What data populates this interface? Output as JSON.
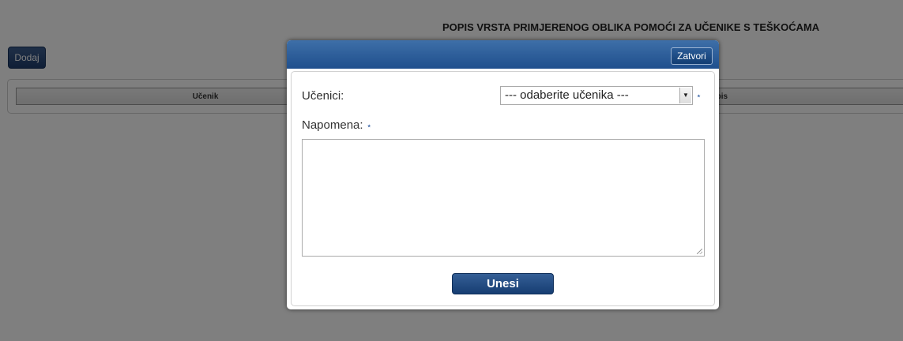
{
  "page": {
    "title": "POPIS VRSTA PRIMJERENOG OBLIKA POMOĆI ZA UČENIKE S TEŠKOĆAMA",
    "add_button": "Dodaj",
    "table_headers": [
      "Učenik",
      "Opis"
    ]
  },
  "dialog": {
    "close_button": "Zatvori",
    "students_label": "Učenici:",
    "students_select_value": "--- odaberite učenika ---",
    "note_label": "Napomena:",
    "required_mark": "⋆",
    "note_value": "",
    "submit_button": "Unesi"
  },
  "colors": {
    "primary": "#1f4f8d",
    "overlay": "rgba(0,0,0,0.5)",
    "required": "#3b66a8"
  }
}
